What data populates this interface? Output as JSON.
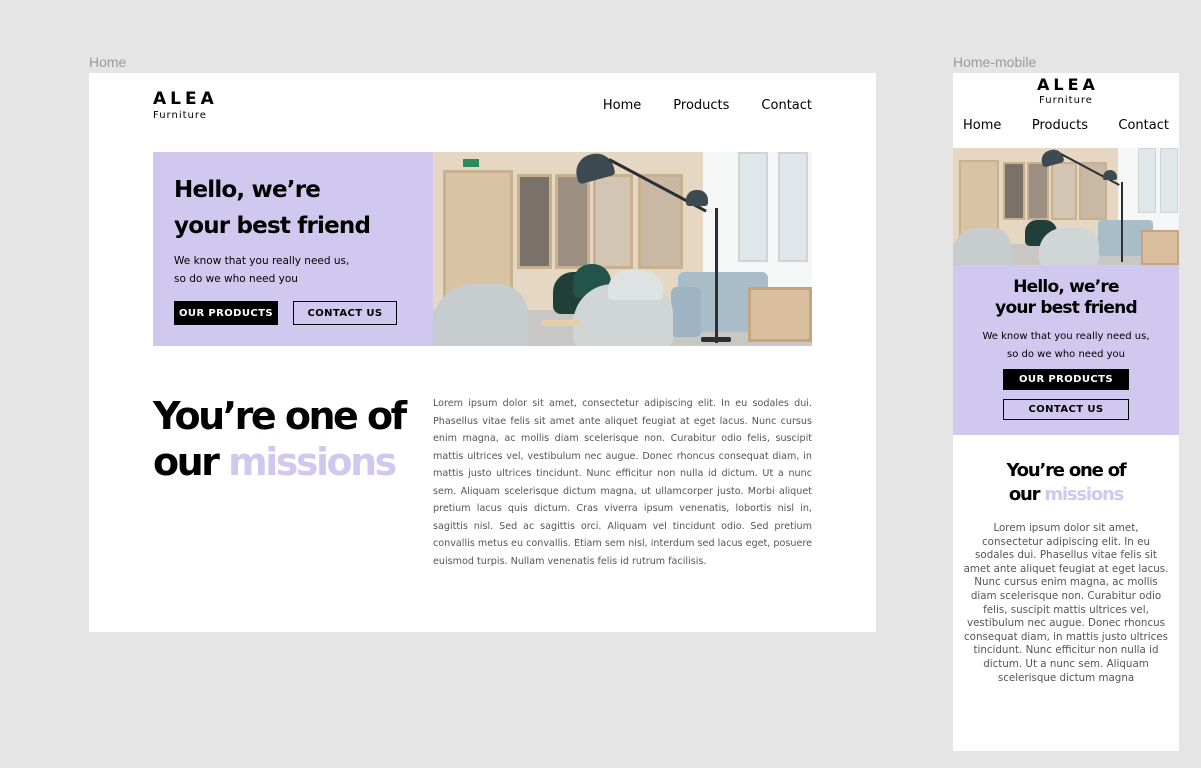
{
  "desktop": {
    "frame_label": "Home",
    "logo": {
      "brand": "ALEA",
      "sub": "Furniture"
    },
    "nav": [
      "Home",
      "Products",
      "Contact"
    ],
    "hero": {
      "title_line1": "Hello, we’re",
      "title_line2": "your best friend",
      "sub_line1": "We know that you really need us,",
      "sub_line2": "so do we who need you",
      "primary_button": "OUR PRODUCTS",
      "secondary_button": "CONTACT US"
    },
    "missions": {
      "line1": "You’re one of",
      "line2_plain": "our ",
      "line2_accent": "missions"
    },
    "lorem": "Lorem ipsum dolor sit amet, consectetur adipiscing elit. In eu sodales dui. Phasellus vitae felis sit amet ante aliquet feugiat at eget lacus. Nunc cursus enim magna, ac mollis diam scelerisque non. Curabitur odio felis, suscipit mattis ultrices vel, vestibulum nec augue. Donec rhoncus consequat diam, in mattis justo ultrices tincidunt. Nunc efficitur non nulla id dictum. Ut a nunc sem. Aliquam scelerisque dictum magna, ut ullamcorper justo. Morbi aliquet pretium lacus quis dictum. Cras viverra ipsum venenatis, lobortis nisl in, sagittis nisl. Sed ac sagittis orci. Aliquam vel tincidunt odio. Sed pretium convallis metus eu convallis. Etiam sem nisl, interdum sed lacus eget, posuere euismod turpis. Nullam venenatis felis id rutrum facilisis."
  },
  "mobile": {
    "frame_label": "Home-mobile",
    "logo": {
      "brand": "ALEA",
      "sub": "Furniture"
    },
    "nav": [
      "Home",
      "Products",
      "Contact"
    ],
    "hero": {
      "title_line1": "Hello, we’re",
      "title_line2": "your best friend",
      "sub_line1": "We know that you really need us,",
      "sub_line2": "so do we who need you",
      "primary_button": "OUR PRODUCTS",
      "secondary_button": "CONTACT US"
    },
    "missions": {
      "line1": "You’re one of",
      "line2_plain": "our ",
      "line2_accent": "missions"
    },
    "lorem": "Lorem ipsum dolor sit amet, consectetur adipiscing elit. In eu sodales dui. Phasellus vitae felis sit amet ante aliquet feugiat at eget lacus. Nunc cursus enim magna, ac mollis diam scelerisque non. Curabitur odio felis, suscipit mattis ultrices vel, vestibulum nec augue. Donec rhoncus consequat diam, in mattis justo ultrices tincidunt. Nunc efficitur non nulla id dictum. Ut a nunc sem. Aliquam scelerisque dictum magna"
  },
  "colors": {
    "canvas": "#e5e5e5",
    "accent_lavender": "#d1c8ef",
    "text": "#000000",
    "body_text": "#555555"
  },
  "icons": [
    "interior-photo"
  ]
}
